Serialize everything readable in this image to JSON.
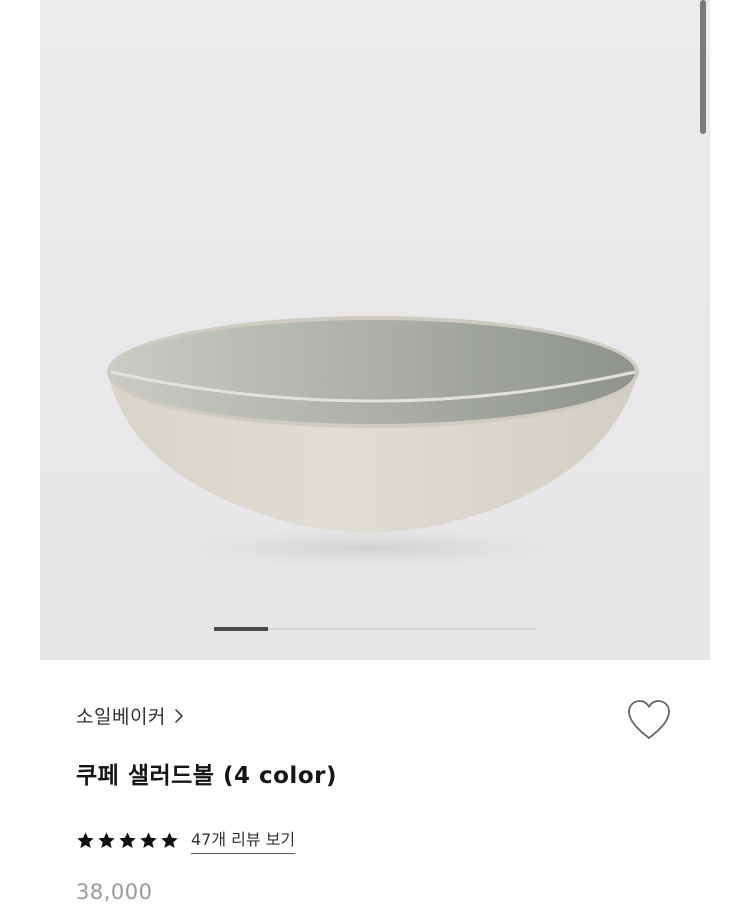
{
  "product": {
    "brand": "소일베이커",
    "title": "쿠페 샐러드볼 (4 color)",
    "rating_stars": 5,
    "review_link": "47개 리뷰 보기",
    "price": "38,000"
  },
  "gallery": {
    "current_slide_fraction": 0.17
  },
  "icons": {
    "brand_chevron": "chevron-right-icon",
    "wishlist": "heart-outline-icon",
    "star": "star-filled-icon"
  },
  "colors": {
    "background": "#ffffff",
    "photo_background": "#e9e9eb",
    "bowl_outer": "#dcd8cd",
    "bowl_inner": "#b9bcb4",
    "text_primary": "#151515",
    "price": "#9a9a9a"
  }
}
